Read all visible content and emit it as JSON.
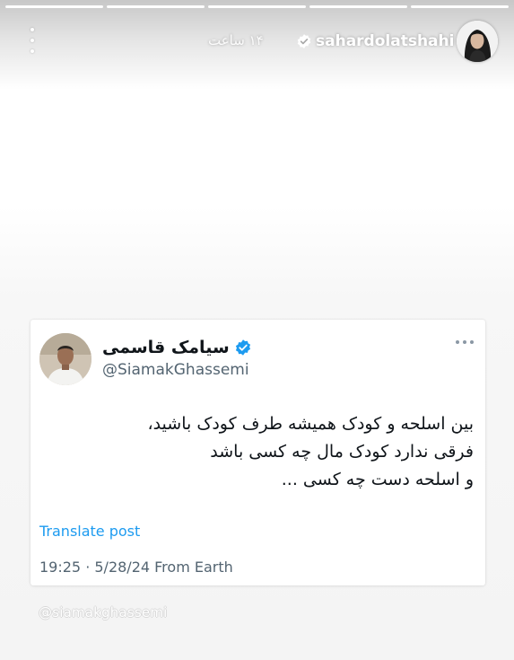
{
  "story": {
    "segments": [
      {
        "state": "done"
      },
      {
        "state": "done"
      },
      {
        "state": "done"
      },
      {
        "state": "done"
      },
      {
        "state": "current"
      }
    ],
    "author": {
      "username": "sahardolatshahi",
      "verified": true,
      "time_ago": "۱۴ ساعت"
    },
    "menu_icon": "vertical-ellipsis-icon"
  },
  "tweet": {
    "display_name": "سیامک قاسمی",
    "verified": true,
    "handle": "@SiamakGhassemi",
    "text_lines": [
      "بین اسلحه و کودک همیشه طرف کودک باشید،",
      "فرقی ندارد کودک مال چه کسی باشد",
      "و اسلحه دست چه کسی ..."
    ],
    "translate_label": "Translate post",
    "meta": "19:25 · 5/28/24 From Earth",
    "more_icon": "horizontal-ellipsis-icon",
    "verified_color": "#1d9bf0"
  },
  "mention": {
    "label": "@siamakghassemi"
  },
  "colors": {
    "link": "#1d9bf0",
    "text": "#0f1419",
    "muted": "#536471"
  }
}
